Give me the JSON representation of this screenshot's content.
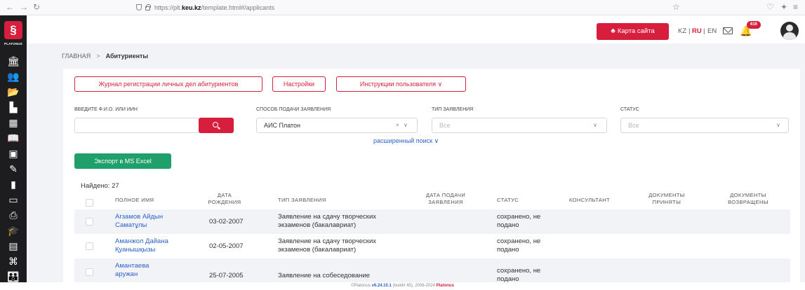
{
  "browser": {
    "url_prefix": "https://plt.",
    "url_domain": "keu.kz",
    "url_suffix": "/template.html#/applicants"
  },
  "sidebar": {
    "logo_text": "PLATONUS",
    "icons": [
      "bank-icon",
      "users-icon",
      "folder-icon",
      "structure-icon",
      "grid-icon",
      "book-icon",
      "presentation-icon",
      "edit-icon",
      "bar-chart-icon",
      "monitor-icon",
      "print-icon",
      "graduation-cap-icon",
      "image-icon",
      "modules-icon",
      "group-icon"
    ]
  },
  "header": {
    "sitemap_label": "Карта сайта",
    "lang_kz": "KZ",
    "lang_ru": "RU",
    "lang_en": "EN",
    "active_lang": "RU",
    "notification_count": "616"
  },
  "breadcrumb": {
    "home": "ГЛАВНАЯ",
    "separator": ">",
    "current": "Абитуриенты"
  },
  "toolbar": {
    "journal_label": "Журнал регистрации личных дел абитуриентов",
    "settings_label": "Настройки",
    "instructions_label": "Инструкции пользователя ∨"
  },
  "filters": {
    "name_label": "ВВЕДИТЕ Ф.И.О. ИЛИ ИИН",
    "name_value": "",
    "method_label": "СПОСОБ ПОДАЧИ ЗАЯВЛЕНИЯ",
    "method_value": "АИС Платон",
    "type_label": "ТИП ЗАЯВЛЕНИЯ",
    "type_value": "Все",
    "status_label": "СТАТУС",
    "status_value": "Все",
    "advanced_search": "расширенный поиск ∨"
  },
  "export_label": "Экспорт в MS Excel",
  "found_text": "Найдено: 27",
  "table": {
    "headers": {
      "full_name": "ПОЛНОЕ ИМЯ",
      "birth_date_1": "ДАТА",
      "birth_date_2": "РОЖДЕНИЯ",
      "app_type": "ТИП ЗАЯВЛЕНИЯ",
      "submit_date_1": "ДАТА ПОДАЧИ",
      "submit_date_2": "ЗАЯВЛЕНИЯ",
      "status": "СТАТУС",
      "consultant": "КОНСУЛЬТАНТ",
      "docs_accepted_1": "ДОКУМЕНТЫ",
      "docs_accepted_2": "ПРИНЯТЫ",
      "docs_returned_1": "ДОКУМЕНТЫ",
      "docs_returned_2": "ВОЗВРАЩЕНЫ"
    },
    "rows": [
      {
        "name_1": "Агзамов Айдын",
        "name_2": "Саматұлы",
        "birth_date": "03-02-2007",
        "type_1": "Заявление на сдачу творческих",
        "type_2": "экзаменов (бакалавриат)",
        "status_1": "сохранено, не",
        "status_2": "подано"
      },
      {
        "name_1": "Аманжол Дайана",
        "name_2": "Қуанышқызы",
        "birth_date": "02-05-2007",
        "type_1": "Заявление на сдачу творческих",
        "type_2": "экзаменов (бакалавриат)",
        "status_1": "сохранено, не",
        "status_2": "подано"
      },
      {
        "name_1": "Амантаева",
        "name_2": "аружан",
        "birth_date": "25-07-2005",
        "type_1": "Заявление на собеседование",
        "type_2": "",
        "status_1": "сохранено, не",
        "status_2": "подано"
      }
    ]
  },
  "footer": {
    "prefix": "©Platonus ",
    "version": "v6.24.10.1",
    "middle": " (build# 45), 2006-2024 ",
    "brand": "Platonus"
  },
  "colors": {
    "accent": "#d71e3c",
    "link": "#2a62c9",
    "excel": "#1fa06b",
    "sidebar": "#1d1d1f",
    "background": "#f2f3f7"
  }
}
